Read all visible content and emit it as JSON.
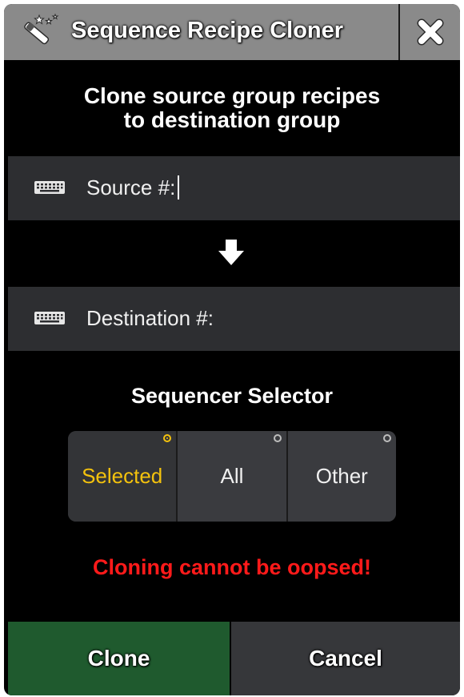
{
  "window": {
    "title": "Sequence Recipe Cloner",
    "title_icon": "magic-wand-icon",
    "close_icon": "close-icon"
  },
  "header": {
    "line1": "Clone source group recipes",
    "line2": "to destination group"
  },
  "source": {
    "label": "Source #:",
    "value": "",
    "icon": "keyboard-icon"
  },
  "arrow_icon": "arrow-down-icon",
  "destination": {
    "label": "Destination #:",
    "value": "",
    "icon": "keyboard-icon"
  },
  "selector": {
    "title": "Sequencer Selector",
    "options": [
      {
        "label": "Selected",
        "selected": true
      },
      {
        "label": "All",
        "selected": false
      },
      {
        "label": "Other",
        "selected": false
      }
    ]
  },
  "warning": "Cloning cannot be oopsed!",
  "buttons": {
    "clone": "Clone",
    "cancel": "Cancel"
  },
  "colors": {
    "accent_selected": "#f4c20d",
    "warning": "#ff1a1a",
    "clone_button": "#1f5a2e",
    "title_bar": "#8a8a8a"
  }
}
